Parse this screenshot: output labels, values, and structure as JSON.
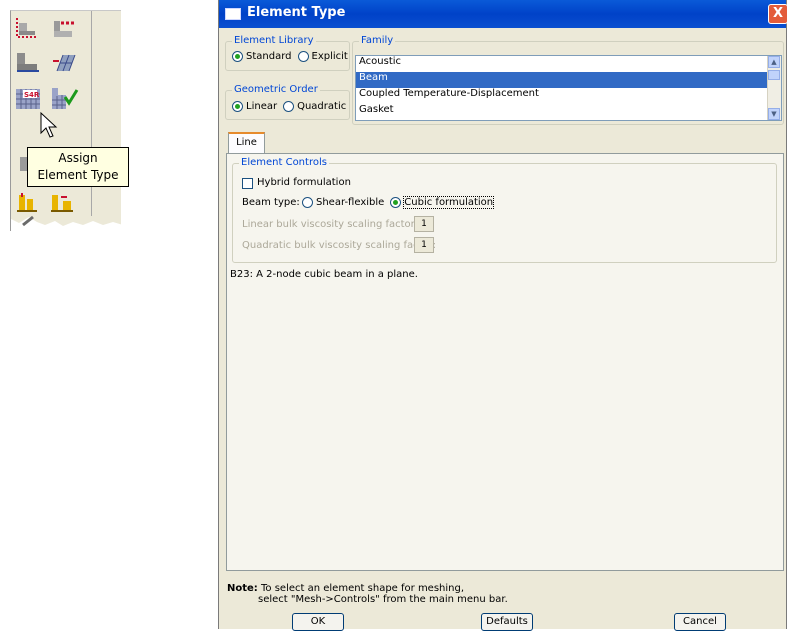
{
  "toolbox": {
    "tooltip_line1": "Assign",
    "tooltip_line2": "Element Type",
    "icons": [
      "seed-part-icon",
      "seed-edge-icon",
      "mesh-part-icon",
      "mesh-region-icon",
      "assign-element-type-icon",
      "verify-mesh-icon",
      "partition-face-icon",
      "partition-edge-icon"
    ]
  },
  "dialog": {
    "title": "Element Type",
    "close_label": "X",
    "element_library": {
      "label": "Element Library",
      "options": [
        "Standard",
        "Explicit"
      ],
      "selected": "Standard"
    },
    "geometric_order": {
      "label": "Geometric Order",
      "options": [
        "Linear",
        "Quadratic"
      ],
      "selected": "Linear"
    },
    "family": {
      "label": "Family",
      "items": [
        "Acoustic",
        "Beam",
        "Coupled Temperature-Displacement",
        "Gasket"
      ],
      "selected": "Beam"
    },
    "tabs": [
      {
        "label": "Line",
        "active": true
      }
    ],
    "element_controls": {
      "label": "Element Controls",
      "hybrid_label": "Hybrid formulation",
      "hybrid_checked": false,
      "beam_type_label": "Beam type:",
      "beam_type_options": [
        "Shear-flexible",
        "Cubic formulation"
      ],
      "beam_type_selected": "Cubic formulation",
      "linear_bulk_label": "Linear bulk viscosity scaling factor:",
      "linear_bulk_value": "1",
      "quadratic_bulk_label": "Quadratic bulk viscosity scaling factor:",
      "quadratic_bulk_value": "1"
    },
    "description": "B23:  A 2-node cubic beam in a plane.",
    "note": {
      "prefix": "Note:",
      "line1": "To select an element shape for meshing,",
      "line2": "select \"Mesh->Controls\" from the main menu bar."
    },
    "buttons": {
      "ok": "OK",
      "defaults": "Defaults",
      "cancel": "Cancel"
    }
  }
}
